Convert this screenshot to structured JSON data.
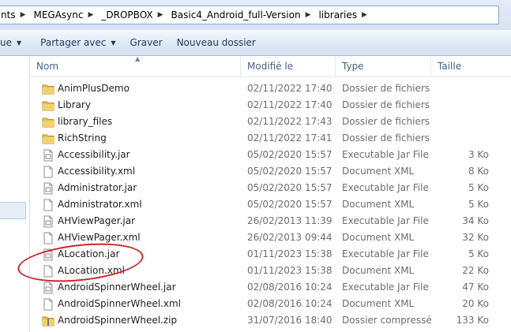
{
  "address": {
    "crumbs": [
      "nts",
      "MEGAsync",
      "_DROPBOX",
      "Basic4_Android_full-Version",
      "libraries"
    ]
  },
  "toolbar": {
    "items": [
      {
        "label": "ue",
        "has_menu": true
      },
      {
        "label": "Partager avec",
        "has_menu": true
      },
      {
        "label": "Graver",
        "has_menu": false
      },
      {
        "label": "Nouveau dossier",
        "has_menu": false
      }
    ]
  },
  "columns": {
    "name": "Nom",
    "modified": "Modifié le",
    "type": "Type",
    "size": "Taille"
  },
  "files": [
    {
      "name": "AnimPlusDemo",
      "date": "02/11/2022 17:40",
      "type": "Dossier de fichiers",
      "size": "",
      "icon": "folder-icon"
    },
    {
      "name": "Library",
      "date": "02/11/2022 17:40",
      "type": "Dossier de fichiers",
      "size": "",
      "icon": "folder-icon"
    },
    {
      "name": "library_files",
      "date": "02/11/2022 17:43",
      "type": "Dossier de fichiers",
      "size": "",
      "icon": "folder-icon"
    },
    {
      "name": "RichString",
      "date": "02/11/2022 17:41",
      "type": "Dossier de fichiers",
      "size": "",
      "icon": "folder-icon"
    },
    {
      "name": "Accessibility.jar",
      "date": "05/02/2020 15:57",
      "type": "Executable Jar File",
      "size": "3 Ko",
      "icon": "jar-file-icon"
    },
    {
      "name": "Accessibility.xml",
      "date": "05/02/2020 15:57",
      "type": "Document XML",
      "size": "8 Ko",
      "icon": "xml-file-icon"
    },
    {
      "name": "Administrator.jar",
      "date": "05/02/2020 15:57",
      "type": "Executable Jar File",
      "size": "5 Ko",
      "icon": "jar-file-icon"
    },
    {
      "name": "Administrator.xml",
      "date": "05/02/2020 15:57",
      "type": "Document XML",
      "size": "5 Ko",
      "icon": "xml-file-icon"
    },
    {
      "name": "AHViewPager.jar",
      "date": "26/02/2013 11:39",
      "type": "Executable Jar File",
      "size": "34 Ko",
      "icon": "jar-file-icon"
    },
    {
      "name": "AHViewPager.xml",
      "date": "26/02/2013 09:44",
      "type": "Document XML",
      "size": "32 Ko",
      "icon": "xml-file-icon"
    },
    {
      "name": "ALocation.jar",
      "date": "01/11/2023 15:38",
      "type": "Executable Jar File",
      "size": "5 Ko",
      "icon": "jar-file-icon"
    },
    {
      "name": "ALocation.xml",
      "date": "01/11/2023 15:38",
      "type": "Document XML",
      "size": "22 Ko",
      "icon": "xml-file-icon"
    },
    {
      "name": "AndroidSpinnerWheel.jar",
      "date": "02/08/2016 10:24",
      "type": "Executable Jar File",
      "size": "47 Ko",
      "icon": "jar-file-icon"
    },
    {
      "name": "AndroidSpinnerWheel.xml",
      "date": "02/08/2016 10:24",
      "type": "Document XML",
      "size": "20 Ko",
      "icon": "xml-file-icon"
    },
    {
      "name": "AndroidSpinnerWheel.zip",
      "date": "31/07/2016 18:40",
      "type": "Dossier compressé",
      "size": "133 Ko",
      "icon": "zip-folder-icon"
    }
  ],
  "colors": {
    "highlight_circle": "#c9262b",
    "folder": "#e8c04a"
  }
}
